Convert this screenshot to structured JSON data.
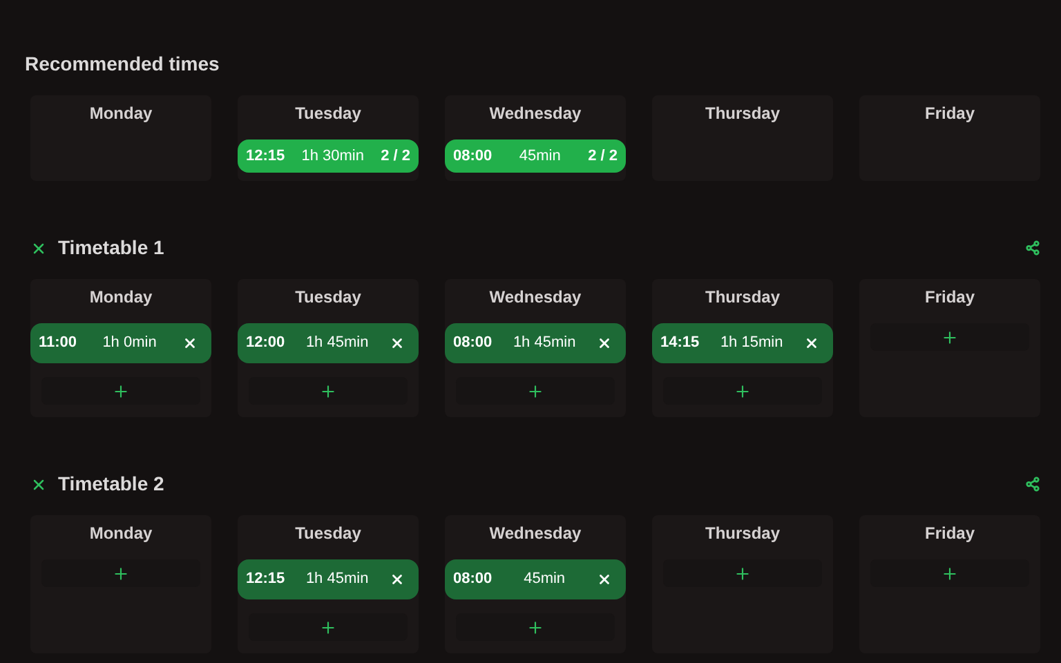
{
  "recommended": {
    "title": "Recommended times",
    "days": [
      {
        "name": "Monday"
      },
      {
        "name": "Tuesday",
        "slots": [
          {
            "time": "12:15",
            "duration": "1h 30min",
            "count": "2 / 2"
          }
        ]
      },
      {
        "name": "Wednesday",
        "slots": [
          {
            "time": "08:00",
            "duration": "45min",
            "count": "2 / 2"
          }
        ]
      },
      {
        "name": "Thursday"
      },
      {
        "name": "Friday"
      }
    ]
  },
  "timetables": [
    {
      "title": "Timetable 1",
      "days": [
        {
          "name": "Monday",
          "slots": [
            {
              "time": "11:00",
              "duration": "1h 0min"
            }
          ]
        },
        {
          "name": "Tuesday",
          "slots": [
            {
              "time": "12:00",
              "duration": "1h 45min"
            }
          ]
        },
        {
          "name": "Wednesday",
          "slots": [
            {
              "time": "08:00",
              "duration": "1h 45min"
            }
          ]
        },
        {
          "name": "Thursday",
          "slots": [
            {
              "time": "14:15",
              "duration": "1h 15min"
            }
          ]
        },
        {
          "name": "Friday"
        }
      ]
    },
    {
      "title": "Timetable 2",
      "days": [
        {
          "name": "Monday"
        },
        {
          "name": "Tuesday",
          "slots": [
            {
              "time": "12:15",
              "duration": "1h 45min"
            }
          ]
        },
        {
          "name": "Wednesday",
          "slots": [
            {
              "time": "08:00",
              "duration": "45min"
            }
          ]
        },
        {
          "name": "Thursday"
        },
        {
          "name": "Friday"
        }
      ]
    }
  ]
}
